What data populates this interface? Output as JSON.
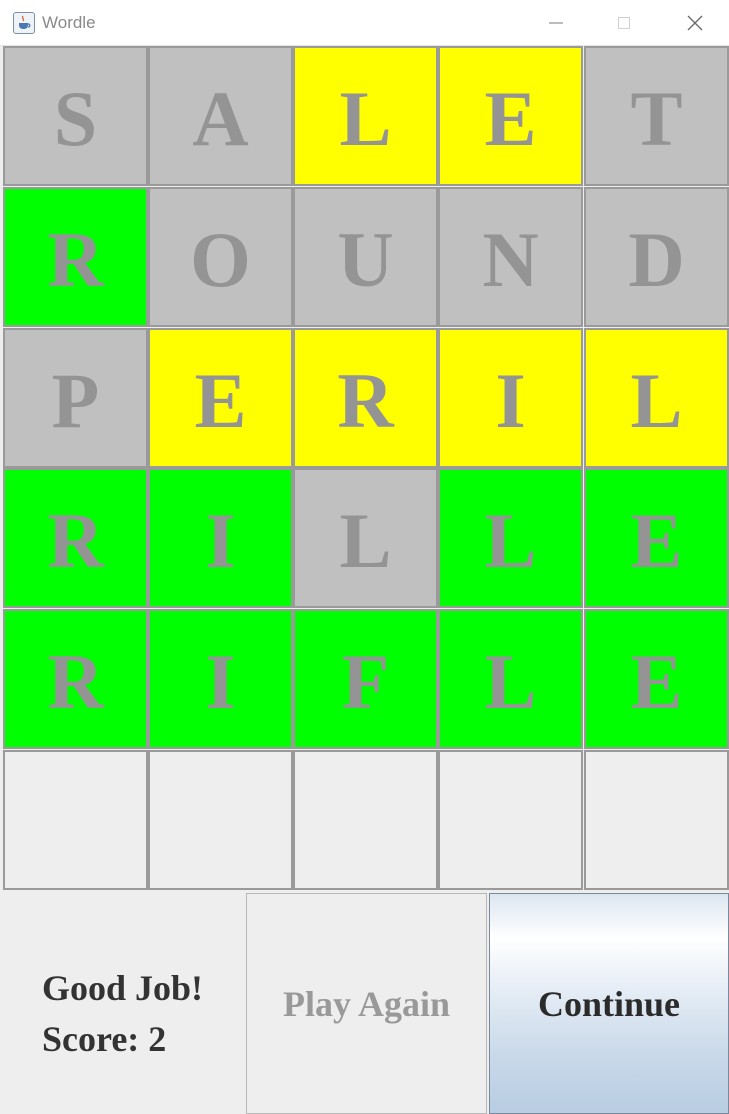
{
  "window": {
    "title": "Wordle",
    "minimize_icon": "minimize-icon",
    "maximize_icon": "maximize-icon",
    "close_icon": "close-icon",
    "app_icon": "java-cup-icon"
  },
  "colors": {
    "green": "#00ff00",
    "yellow": "#ffff00",
    "gray": "#c0c0c0",
    "empty": "#eeeeee",
    "letter": "#949494"
  },
  "board": {
    "rows": [
      [
        {
          "letter": "S",
          "state": "gray"
        },
        {
          "letter": "A",
          "state": "gray"
        },
        {
          "letter": "L",
          "state": "yellow"
        },
        {
          "letter": "E",
          "state": "yellow"
        },
        {
          "letter": "T",
          "state": "gray"
        }
      ],
      [
        {
          "letter": "R",
          "state": "green"
        },
        {
          "letter": "O",
          "state": "gray"
        },
        {
          "letter": "U",
          "state": "gray"
        },
        {
          "letter": "N",
          "state": "gray"
        },
        {
          "letter": "D",
          "state": "gray"
        }
      ],
      [
        {
          "letter": "P",
          "state": "gray"
        },
        {
          "letter": "E",
          "state": "yellow"
        },
        {
          "letter": "R",
          "state": "yellow"
        },
        {
          "letter": "I",
          "state": "yellow"
        },
        {
          "letter": "L",
          "state": "yellow"
        }
      ],
      [
        {
          "letter": "R",
          "state": "green"
        },
        {
          "letter": "I",
          "state": "green"
        },
        {
          "letter": "L",
          "state": "gray"
        },
        {
          "letter": "L",
          "state": "green"
        },
        {
          "letter": "E",
          "state": "green"
        }
      ],
      [
        {
          "letter": "R",
          "state": "green"
        },
        {
          "letter": "I",
          "state": "green"
        },
        {
          "letter": "F",
          "state": "green"
        },
        {
          "letter": "L",
          "state": "green"
        },
        {
          "letter": "E",
          "state": "green"
        }
      ],
      [
        {
          "letter": "",
          "state": "empty"
        },
        {
          "letter": "",
          "state": "empty"
        },
        {
          "letter": "",
          "state": "empty"
        },
        {
          "letter": "",
          "state": "empty"
        },
        {
          "letter": "",
          "state": "empty"
        }
      ]
    ]
  },
  "status": {
    "message": "Good Job!",
    "score_text": "Score: 2"
  },
  "buttons": {
    "play_again": "Play Again",
    "continue": "Continue"
  }
}
